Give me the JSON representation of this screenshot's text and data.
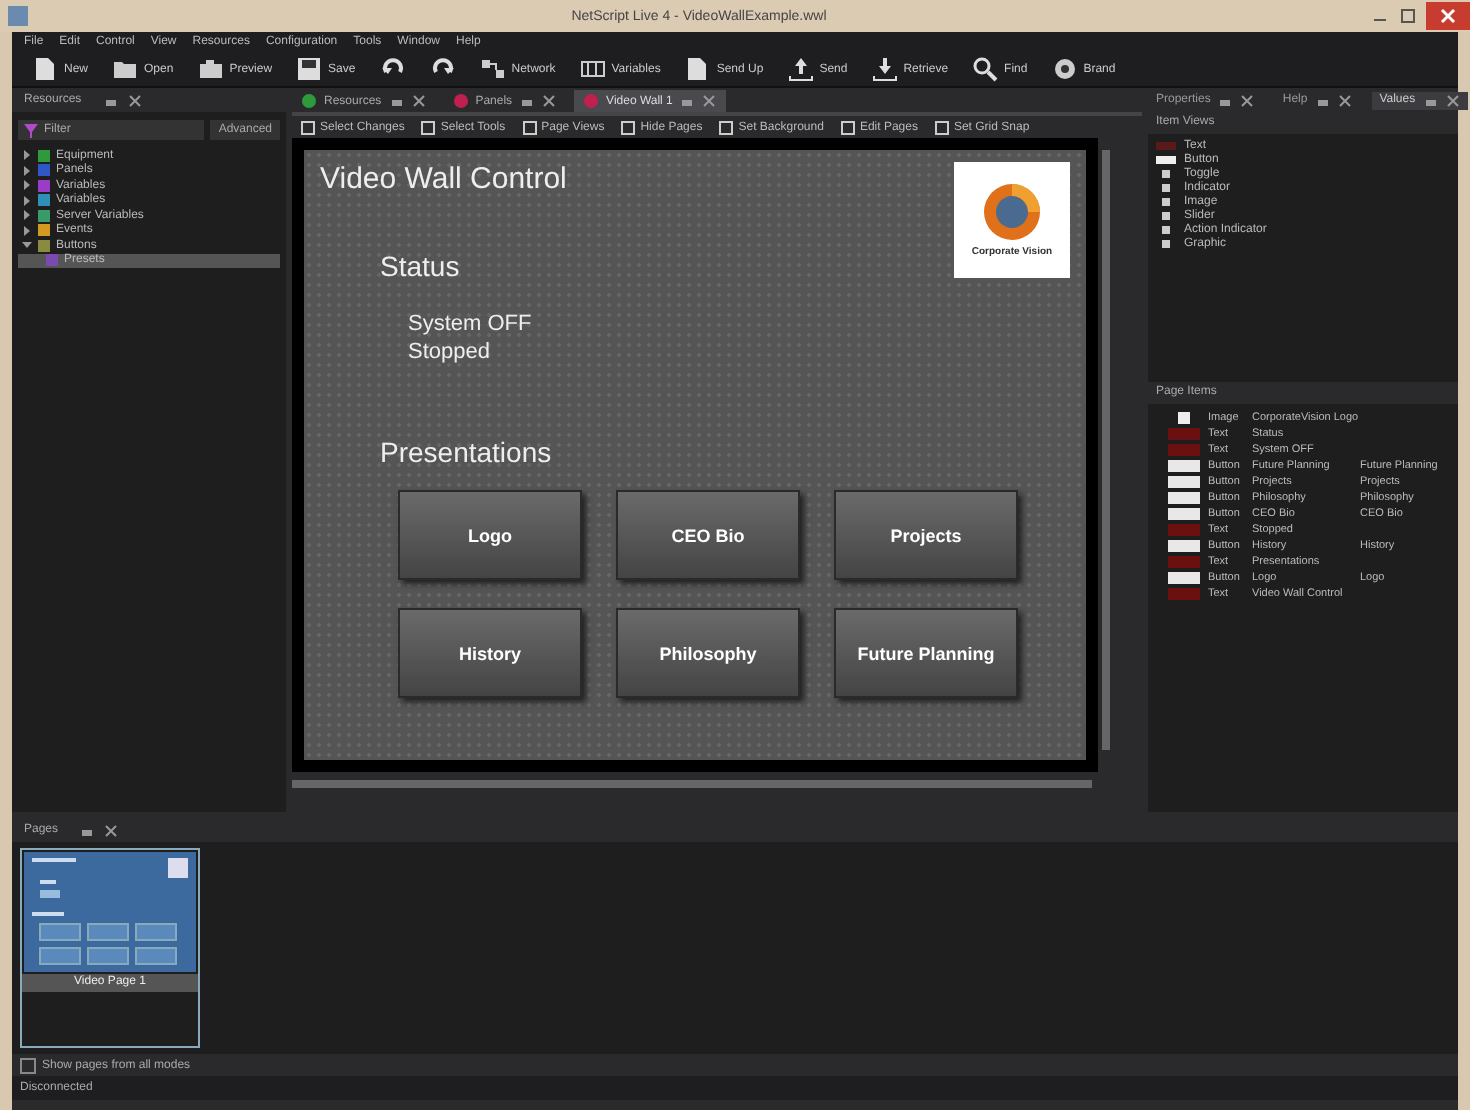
{
  "window": {
    "title": "NetScript Live 4 - VideoWallExample.wwl"
  },
  "menu": [
    "File",
    "Edit",
    "Control",
    "View",
    "Resources",
    "Configuration",
    "Tools",
    "Window",
    "Help"
  ],
  "toolbar": [
    {
      "label": "New",
      "kind": "doc"
    },
    {
      "label": "Open",
      "kind": "folder"
    },
    {
      "label": "Preview",
      "kind": "camera"
    },
    {
      "label": "Save",
      "kind": "save"
    },
    {
      "kind": "undo"
    },
    {
      "kind": "redo"
    },
    {
      "label": "Network",
      "kind": "network"
    },
    {
      "label": "Variables",
      "kind": "vars"
    },
    {
      "label": "Send Up",
      "kind": "doc"
    },
    {
      "label": "Send",
      "kind": "upload"
    },
    {
      "label": "Retrieve",
      "kind": "download"
    },
    {
      "label": "Find",
      "kind": "search"
    },
    {
      "label": "Brand",
      "kind": "gear"
    }
  ],
  "resources_panel": {
    "title": "Resources",
    "filter": "Filter",
    "dropdown": "Advanced",
    "tree": [
      {
        "label": "Equipment",
        "color": "#2e9a3c",
        "selected": false
      },
      {
        "label": "Panels",
        "color": "#2f57c8",
        "selected": false
      },
      {
        "label": "Variables",
        "color": "#9a3cc8",
        "selected": false
      },
      {
        "label": "Variables",
        "color": "#2f8fb8",
        "selected": false
      },
      {
        "label": "Server Variables",
        "color": "#3a9a6a",
        "selected": false
      },
      {
        "label": "Events",
        "color": "#d49a20",
        "selected": false
      },
      {
        "label": "Buttons",
        "color": "#8a8a40",
        "selected": false,
        "children": [
          {
            "label": "Presets",
            "color": "#7a4ab0",
            "selected": true
          }
        ]
      }
    ]
  },
  "document_tabs": [
    {
      "label": "Resources",
      "color": "#2e9a3c",
      "selected": false
    },
    {
      "label": "Panels",
      "color": "#c02050",
      "selected": false
    },
    {
      "label": "Video Wall 1",
      "color": "#c02050",
      "selected": true
    }
  ],
  "editor_toolbar": [
    "Select Changes",
    "Select Tools",
    "Page Views",
    "Hide Pages",
    "Set Background",
    "Edit Pages",
    "Set Grid Snap"
  ],
  "canvas": {
    "title": "Video Wall Control",
    "logo_text": "Corporate Vision",
    "status_heading": "Status",
    "status_lines": [
      "System OFF",
      "Stopped"
    ],
    "presentations_heading": "Presentations",
    "buttons": [
      "Logo",
      "CEO Bio",
      "Projects",
      "History",
      "Philosophy",
      "Future Planning"
    ]
  },
  "right_tabs": [
    {
      "label": "Properties",
      "selected": false
    },
    {
      "label": "Help",
      "selected": false
    },
    {
      "label": "Values",
      "selected": true
    }
  ],
  "item_views": {
    "title": "Item Views",
    "items": [
      {
        "label": "Text",
        "kind": "text"
      },
      {
        "label": "Button",
        "kind": "button"
      },
      {
        "label": "Toggle",
        "kind": "bullet"
      },
      {
        "label": "Indicator",
        "kind": "bullet"
      },
      {
        "label": "Image",
        "kind": "bullet"
      },
      {
        "label": "Slider",
        "kind": "bullet"
      },
      {
        "label": "Action Indicator",
        "kind": "bullet"
      },
      {
        "label": "Graphic",
        "kind": "bullet"
      }
    ]
  },
  "page_items": {
    "title": "Page Items",
    "rows": [
      {
        "kind": "image",
        "type": "Image",
        "name": "CorporateVision Logo"
      },
      {
        "kind": "text",
        "type": "Text",
        "name": "Status"
      },
      {
        "kind": "text",
        "type": "Text",
        "name": "System OFF"
      },
      {
        "kind": "button",
        "type": "Button",
        "name": "Future Planning",
        "text": "Future Planning"
      },
      {
        "kind": "button",
        "type": "Button",
        "name": "Projects",
        "text": "Projects"
      },
      {
        "kind": "button",
        "type": "Button",
        "name": "Philosophy",
        "text": "Philosophy"
      },
      {
        "kind": "button",
        "type": "Button",
        "name": "CEO Bio",
        "text": "CEO Bio"
      },
      {
        "kind": "text",
        "type": "Text",
        "name": "Stopped"
      },
      {
        "kind": "button",
        "type": "Button",
        "name": "History",
        "text": "History"
      },
      {
        "kind": "text",
        "type": "Text",
        "name": "Presentations"
      },
      {
        "kind": "button",
        "type": "Button",
        "name": "Logo",
        "text": "Logo"
      },
      {
        "kind": "text",
        "type": "Text",
        "name": "Video Wall Control"
      }
    ]
  },
  "pages_panel": {
    "title": "Pages",
    "thumbnails": [
      {
        "label": "Video Page 1",
        "selected": true
      }
    ]
  },
  "show_all_pages": {
    "label": "Show pages from all modes",
    "checked": false
  },
  "status_bar": "Disconnected"
}
